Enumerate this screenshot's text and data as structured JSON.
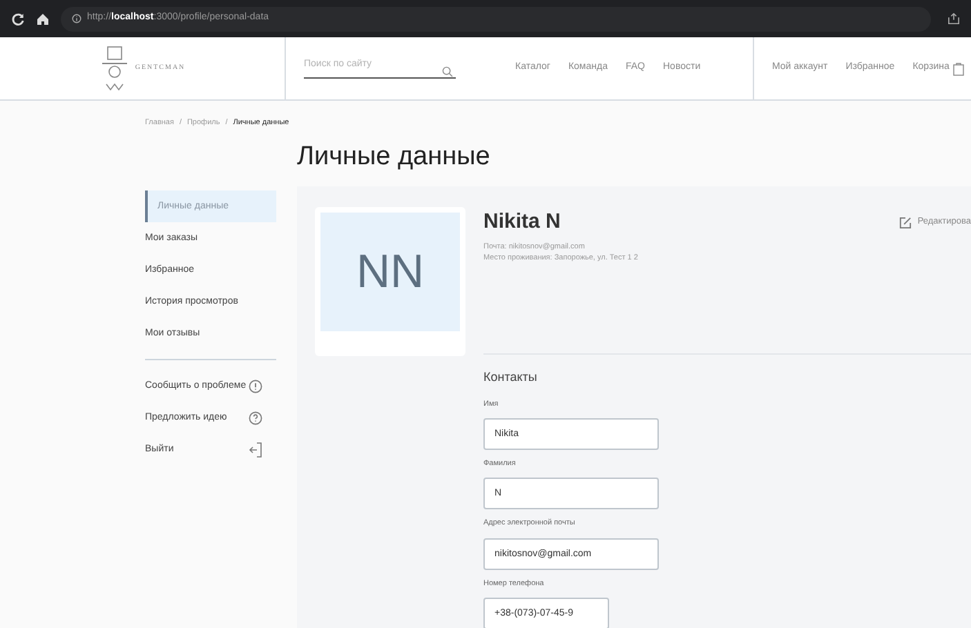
{
  "browser": {
    "url": "http://**localhost**:3000/profile/personal-data"
  },
  "header": {
    "logo_text": "GENTCMAN",
    "search": {
      "placeholder": "Поиск по сайту"
    },
    "nav": [
      "Каталог",
      "Команда",
      "FAQ",
      "Новости"
    ],
    "account_links": [
      "Мой аккаунт",
      "Избранное",
      "Корзина"
    ]
  },
  "breadcrumb_separator": "/",
  "breadcrumb": [
    {
      "label": "Главная",
      "selected": false
    },
    {
      "label": "Профиль",
      "selected": false
    },
    {
      "label": "Личные данные",
      "selected": true
    }
  ],
  "title": "Личные данные",
  "sidebar": {
    "items": [
      {
        "label": "Личные данные",
        "selected": true
      },
      {
        "label": "Мои заказы",
        "selected": false
      },
      {
        "label": "Избранное",
        "selected": false
      },
      {
        "label": "История просмотров",
        "selected": false
      },
      {
        "label": "Мои отзывы",
        "selected": false
      }
    ],
    "actions": [
      {
        "label": "Сообщить о проблеме",
        "kind": "alert"
      },
      {
        "label": "Предложить идею",
        "kind": "question"
      },
      {
        "label": "Выйти",
        "kind": "logout"
      }
    ]
  },
  "profile": {
    "initials": "NN",
    "name": "Nikita N",
    "details": [
      "Почта: nikitosnov@gmail.com",
      "Место проживания: Запорожье, ул. Тест 1 2"
    ],
    "edit_label": "Редактирова"
  },
  "contacts": {
    "title": "Контакты",
    "fields": [
      {
        "label": "Имя",
        "value": "Nikita",
        "wide": true
      },
      {
        "label": "Фамилия",
        "value": "N",
        "wide": true
      },
      {
        "label": "Адрес электронной почты",
        "value": "nikitosnov@gmail.com",
        "wide": true
      },
      {
        "label": "Номер телефона",
        "value": "+38-(073)-07-45-9",
        "wide": false
      }
    ]
  }
}
